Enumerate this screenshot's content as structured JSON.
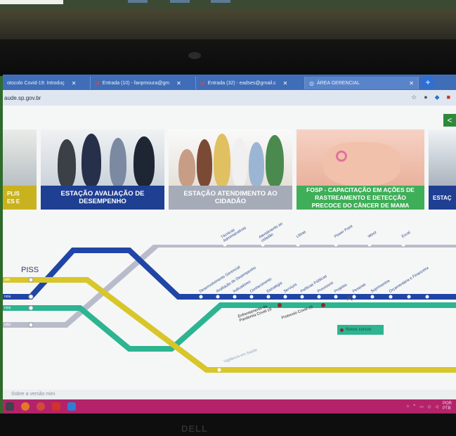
{
  "browser": {
    "tabs": [
      {
        "label": "otocolo Covid-19: Introduç",
        "favicon": "doc-icon",
        "active": false
      },
      {
        "label": "Entrada (10) - fanpmoura@gm",
        "favicon": "gmail-icon",
        "active": false
      },
      {
        "label": "Entrada (32) - eadses@gmail.c",
        "favicon": "gmail-icon",
        "active": false
      },
      {
        "label": "ÁREA GERENCIAL",
        "favicon": "globe-icon",
        "active": true
      }
    ],
    "url": "aude.sp.gov.br",
    "new_tab": "+"
  },
  "cards": [
    {
      "label": "PLIS\nES E",
      "color": "#c9b21f"
    },
    {
      "label": "ESTAÇÃO AVALIAÇÃO DE DESEMPENHO",
      "color": "#1f3f93"
    },
    {
      "label": "ESTAÇÃO ATENDIMENTO AO CIDADÃO",
      "color": "#a6abb8"
    },
    {
      "label": "FOSP - CAPACITAÇÃO EM AÇÕES DE RASTREAMENTO E DETECÇÃO PRECOCE DO CÂNCER DE MAMA",
      "color": "#3fae58"
    },
    {
      "label": "ESTAÇ",
      "color": "#1f3f93"
    }
  ],
  "metro": {
    "origin": "PISS",
    "side_labels": [
      "ado",
      "ncia",
      "ncia",
      "idão"
    ],
    "gray_stations": [
      "Técnicas Administrativas",
      "Atendimento ao cidadão",
      "Libras",
      "Power Point",
      "Word",
      "Excel"
    ],
    "blue_stations": [
      "Desenvolvimento Gerencial",
      "Avaliação de Desempenho",
      "Indicadores",
      "Conhecimento",
      "Estratégia",
      "Serviços",
      "Políticas Públicas",
      "Processos",
      "Projetos",
      "Pessoas",
      "Suprimentos",
      "Orçamentária e Financeira"
    ],
    "green_stations": [
      "Enfrentamento da Pandemia Covid-19",
      "Protocolo Covid-19"
    ],
    "yellow_stations": [
      "Vigilância em Saúde"
    ],
    "legend": "Novos cursos"
  },
  "statusbar": "Sobre a versão mini",
  "tray": {
    "lang": "POR",
    "sub": "PTB"
  },
  "brand": "DELL"
}
